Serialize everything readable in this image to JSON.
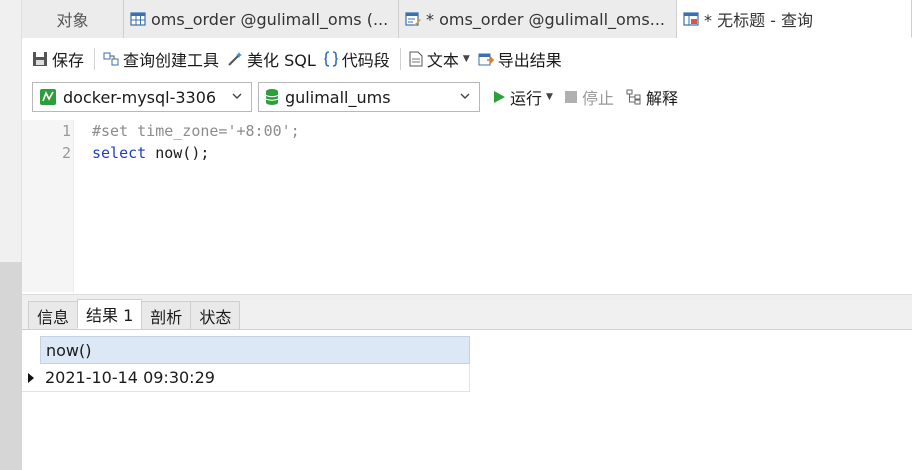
{
  "tabs": [
    {
      "label": "对象",
      "icon": "none"
    },
    {
      "label": "oms_order @gulimall_oms (...",
      "icon": "table-grid-icon"
    },
    {
      "label": "* oms_order @gulimall_oms...",
      "icon": "table-edit-icon"
    },
    {
      "label": "* 无标题 - 查询",
      "icon": "query-icon"
    }
  ],
  "toolbar": {
    "save": "保存",
    "query_builder": "查询创建工具",
    "beautify": "美化 SQL",
    "snippet": "代码段",
    "text": "文本",
    "export": "导出结果"
  },
  "connection": {
    "name": "docker-mysql-3306",
    "database": "gulimall_ums",
    "run": "运行",
    "stop": "停止",
    "explain": "解释"
  },
  "editor": {
    "lines": [
      {
        "number": "1",
        "text": "#set time_zone='+8:00';"
      },
      {
        "number": "2",
        "keyword": "select",
        "rest": " now();"
      }
    ]
  },
  "result_tabs": [
    "信息",
    "结果 1",
    "剖析",
    "状态"
  ],
  "result_grid": {
    "columns": [
      "now()"
    ],
    "rows": [
      [
        "2021-10-14 09:30:29"
      ]
    ]
  },
  "colors": {
    "accent_green": "#2e9e3a",
    "keyword_blue": "#1f3fbf",
    "header_blue": "#dce8f5"
  }
}
